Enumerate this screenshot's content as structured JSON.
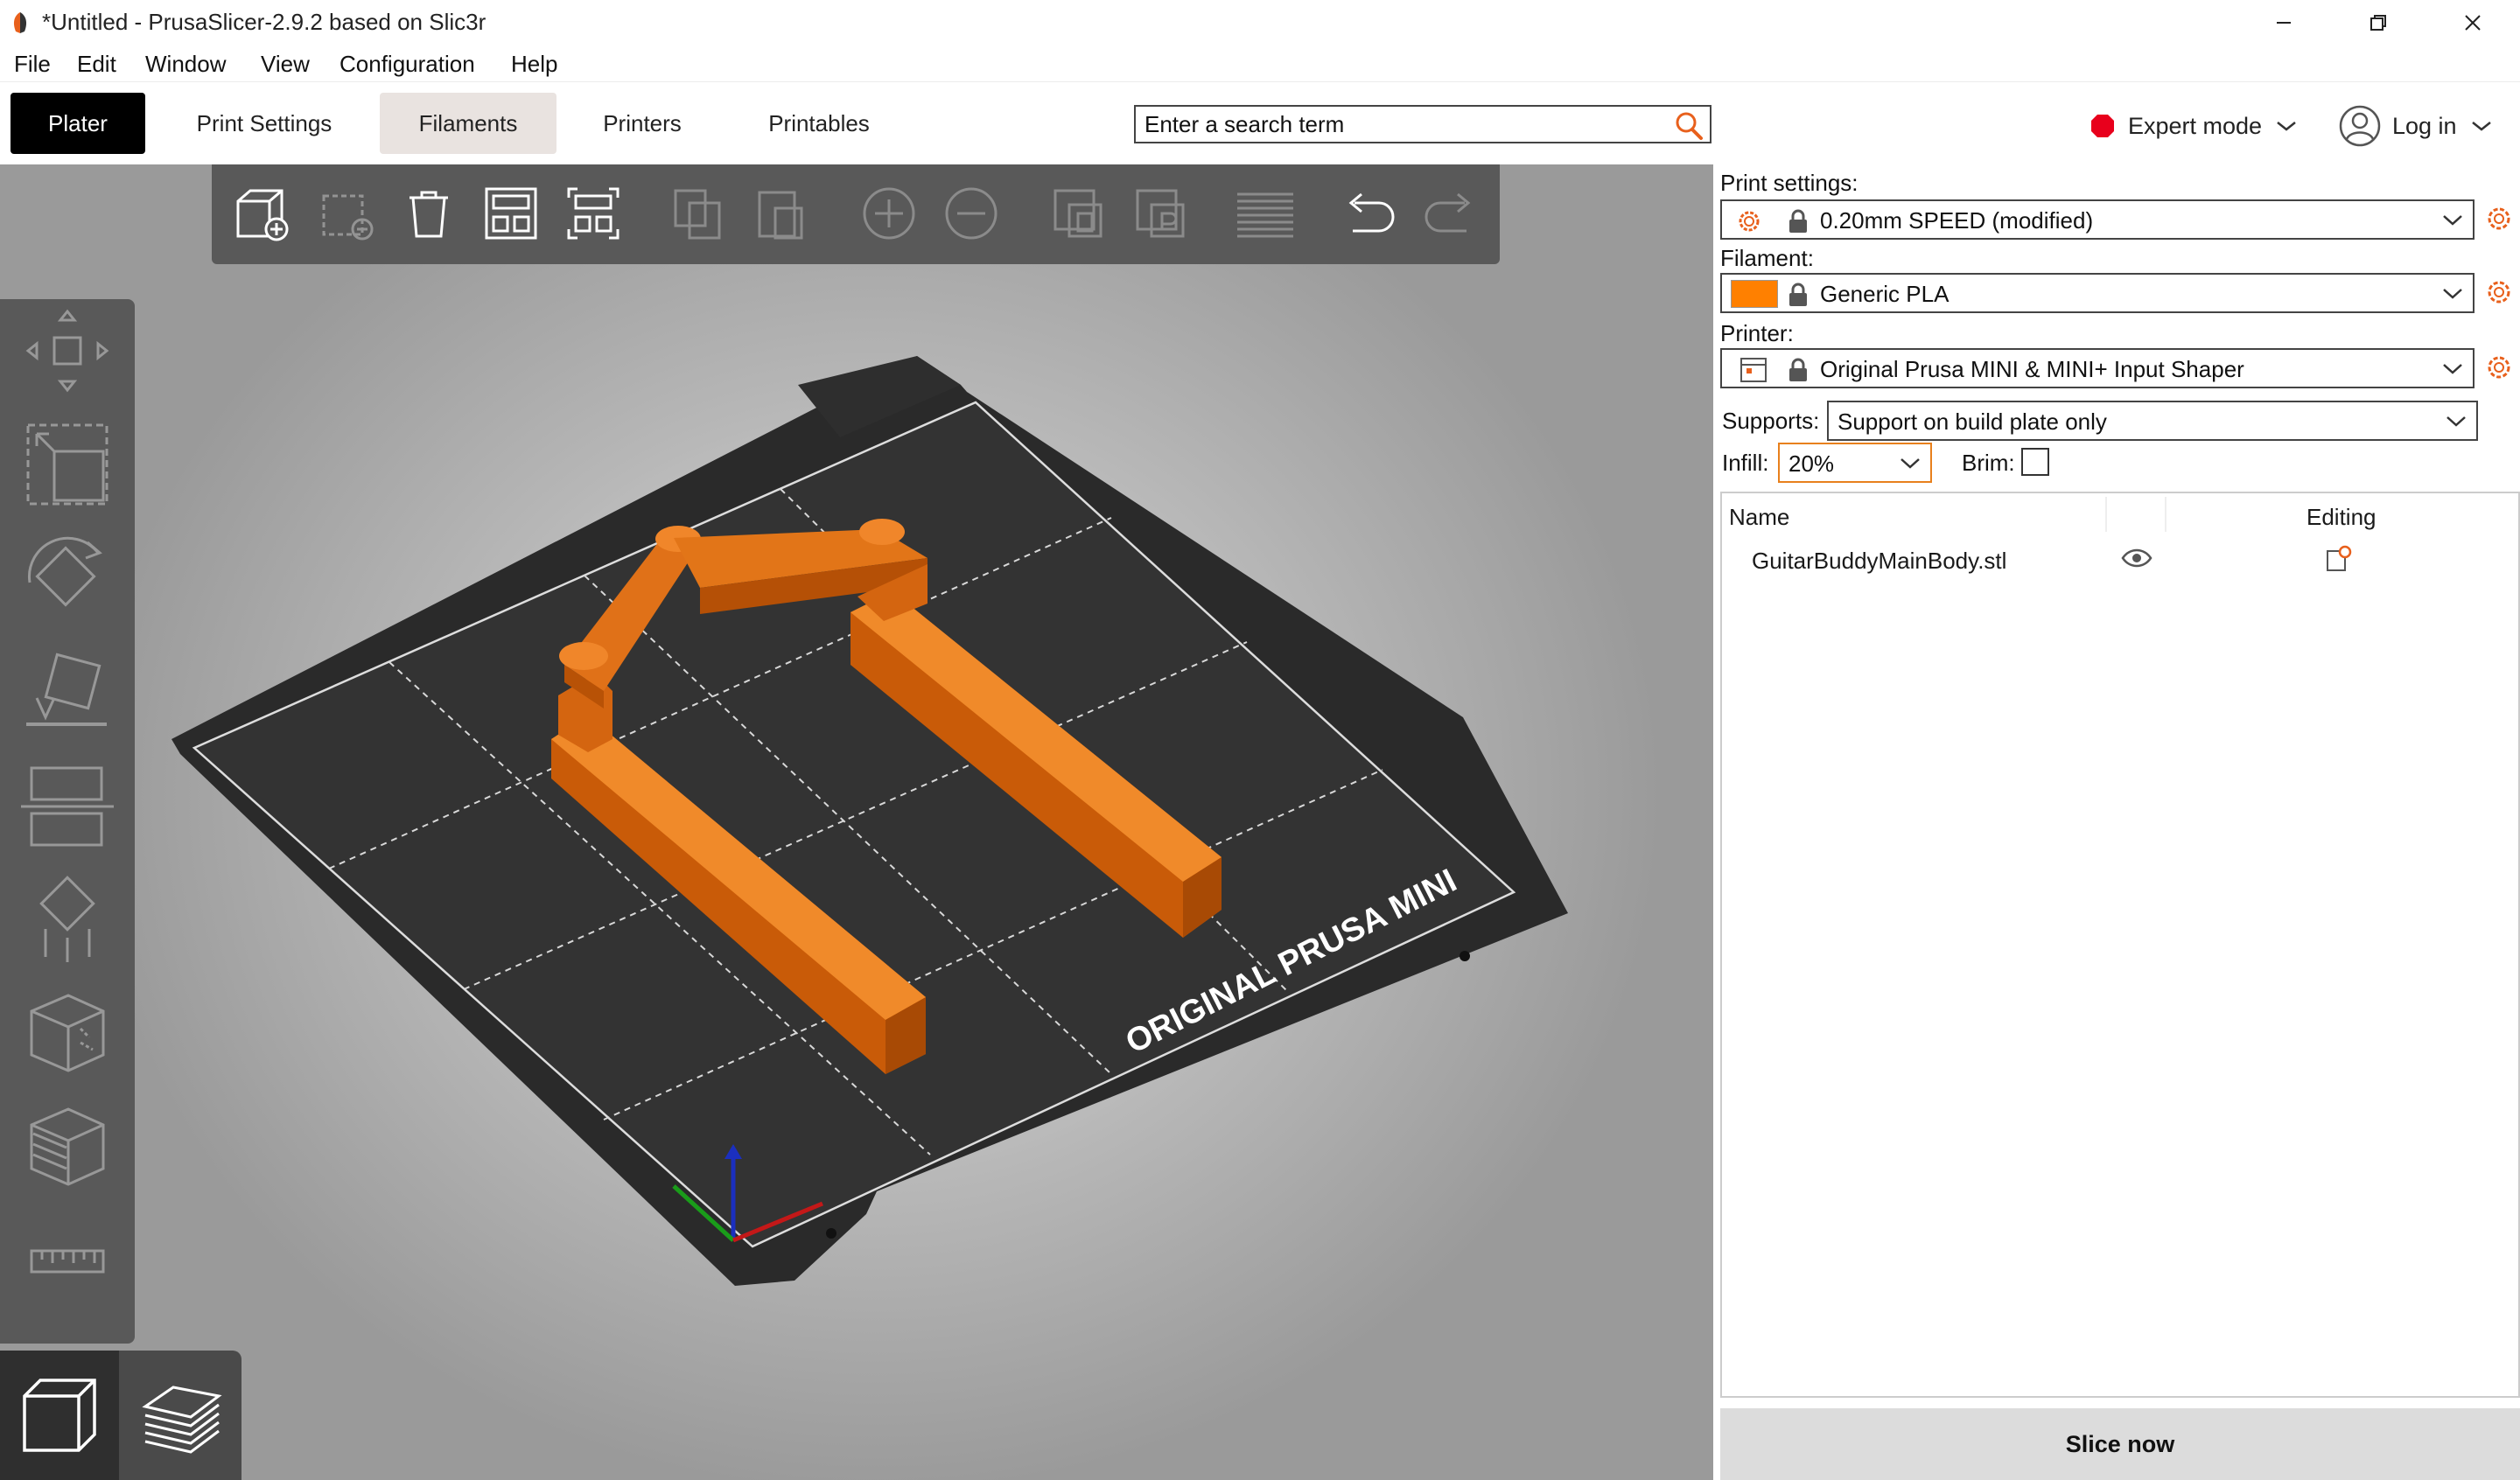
{
  "window": {
    "title": "*Untitled - PrusaSlicer-2.9.2 based on Slic3r",
    "controls": [
      "minimize-icon",
      "restore-icon",
      "close-icon"
    ]
  },
  "menu": [
    "File",
    "Edit",
    "Window",
    "View",
    "Configuration",
    "Help"
  ],
  "tabs": [
    {
      "label": "Plater",
      "state": "active"
    },
    {
      "label": "Print Settings",
      "state": "normal"
    },
    {
      "label": "Filaments",
      "state": "hover"
    },
    {
      "label": "Printers",
      "state": "normal"
    },
    {
      "label": "Printables",
      "state": "normal"
    }
  ],
  "search": {
    "placeholder": "Enter a search term",
    "icon": "search-icon"
  },
  "mode": {
    "label": "Expert mode",
    "color": "#e8001c"
  },
  "login": {
    "label": "Log in"
  },
  "top_toolbar": [
    "add-object-icon",
    "delete-icon",
    "delete-all-icon",
    "arrange-icon",
    "arrange-selection-icon",
    "copy-icon",
    "paste-icon",
    "add-instance-icon",
    "remove-instance-icon",
    "split-objects-icon",
    "split-parts-icon",
    "layers-editing-icon",
    "undo-icon",
    "redo-icon"
  ],
  "left_toolbar": [
    "move-icon",
    "scale-icon",
    "rotate-icon",
    "place-on-face-icon",
    "cut-icon",
    "supports-paint-icon",
    "seam-paint-icon",
    "fuzzy-skin-icon",
    "measure-icon"
  ],
  "view_switch": [
    "3d-view-icon",
    "preview-layers-icon"
  ],
  "bed": {
    "label": "ORIGINAL PRUSA MINI"
  },
  "model_color": "#e06a0a",
  "print_settings": {
    "label": "Print settings:",
    "value": "0.20mm SPEED (modified)"
  },
  "filament": {
    "label": "Filament:",
    "value": "Generic PLA",
    "color": "#ff8000"
  },
  "printer": {
    "label": "Printer:",
    "value": "Original Prusa MINI & MINI+ Input Shaper"
  },
  "supports": {
    "label": "Supports:",
    "value": "Support on build plate only"
  },
  "infill": {
    "label": "Infill:",
    "value": "20%"
  },
  "brim": {
    "label": "Brim:",
    "checked": false
  },
  "object_list": {
    "columns": [
      "Name",
      "",
      "Editing"
    ],
    "rows": [
      {
        "name": "GuitarBuddyMainBody.stl"
      }
    ]
  },
  "slice_button": "Slice now"
}
